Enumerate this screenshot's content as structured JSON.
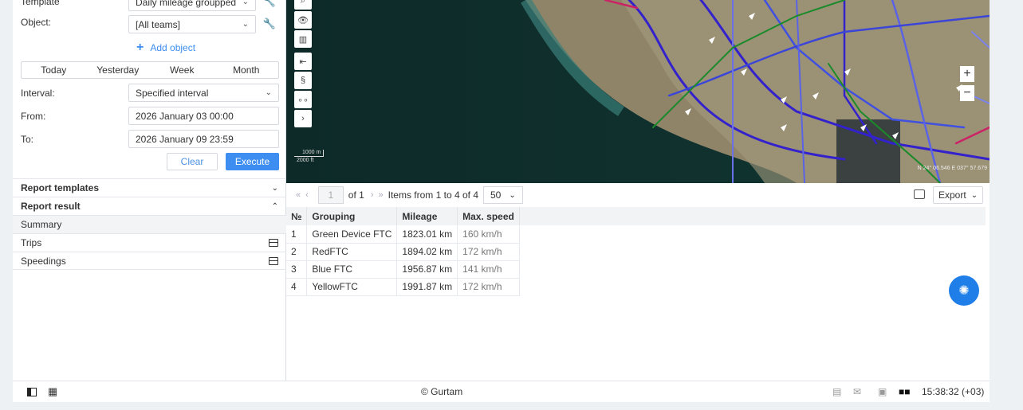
{
  "left": {
    "template_label": "Template",
    "template_value": "Daily mileage groupped",
    "object_label": "Object:",
    "object_value": "[All teams]",
    "add_object": "Add object",
    "periods": [
      "Today",
      "Yesterday",
      "Week",
      "Month"
    ],
    "interval_label": "Interval:",
    "interval_value": "Specified interval",
    "from_label": "From:",
    "from_value": "2026 January 03 00:00",
    "to_label": "To:",
    "to_value": "2026 January 09 23:59",
    "clear_label": "Clear",
    "execute_label": "Execute",
    "report_templates": "Report templates",
    "report_result": "Report result",
    "results": [
      "Summary",
      "Trips",
      "Speedings"
    ]
  },
  "map": {
    "scale_top": "1000 m",
    "scale_bottom": "2000 ft",
    "coords": "N 24° 06.546 E 037° 57.679",
    "zoom_in": "+",
    "zoom_out": "−"
  },
  "pager": {
    "page": "1",
    "of": "of 1",
    "items": "Items from 1 to 4 of 4",
    "per_page": "50",
    "export": "Export"
  },
  "table": {
    "headers": [
      "№",
      "Grouping",
      "Mileage",
      "Max. speed"
    ],
    "rows": [
      [
        "1",
        "Green Device FTC",
        "1823.01 km",
        "160 km/h"
      ],
      [
        "2",
        "RedFTC",
        "1894.02 km",
        "172 km/h"
      ],
      [
        "3",
        "Blue FTC",
        "1956.87 km",
        "141 km/h"
      ],
      [
        "4",
        "YellowFTC",
        "1991.87 km",
        "172 km/h"
      ]
    ]
  },
  "footer": {
    "copyright": "© Gurtam",
    "time": "15:38:32 (+03)"
  },
  "colors": {
    "accent": "#3d8ef0",
    "bulb": "#1f7ee8"
  }
}
